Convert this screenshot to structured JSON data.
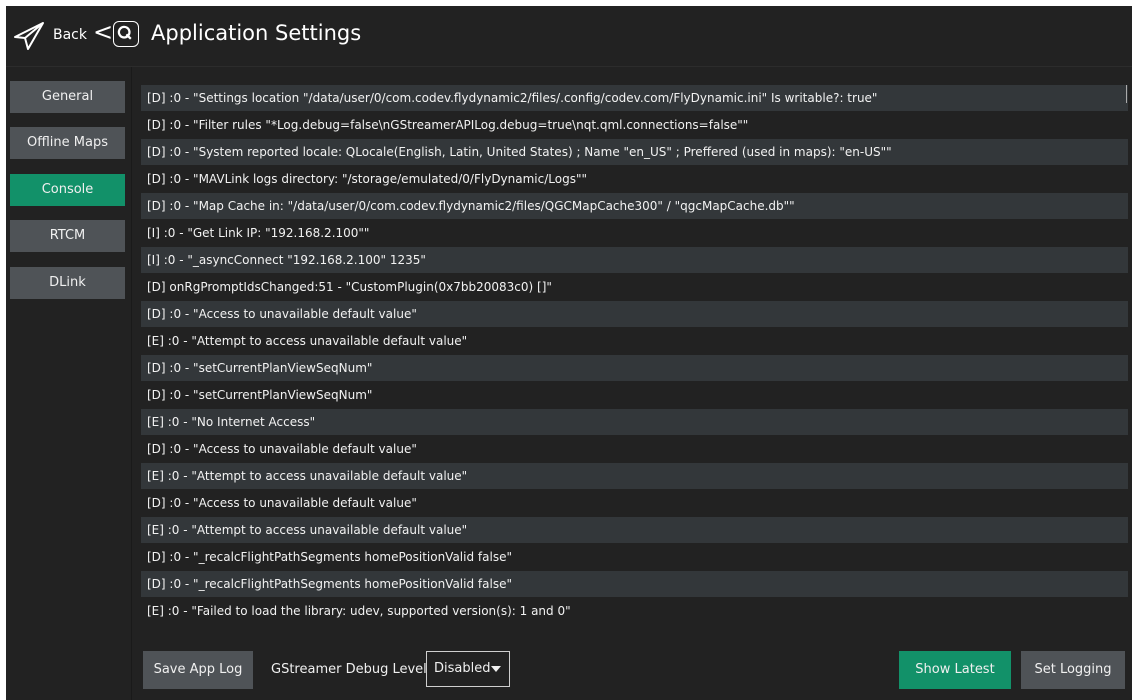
{
  "header": {
    "back_label": "Back",
    "back_chevron": "<",
    "title": "Application Settings"
  },
  "sidebar": {
    "items": [
      {
        "label": "General"
      },
      {
        "label": "Offline Maps"
      },
      {
        "label": "Console",
        "active": true
      },
      {
        "label": "RTCM"
      },
      {
        "label": "DLink"
      }
    ]
  },
  "console": {
    "lines": [
      "[D] :0 - \"Settings location \"/data/user/0/com.codev.flydynamic2/files/.config/codev.com/FlyDynamic.ini\" Is writable?: true\"",
      "[D] :0 - \"Filter rules \"*Log.debug=false\\nGStreamerAPILog.debug=true\\nqt.qml.connections=false\"\"",
      "[D] :0 - \"System reported locale: QLocale(English, Latin, United States) ; Name \"en_US\" ; Preffered (used in maps):  \"en-US\"\"",
      "[D] :0 - \"MAVLink logs directory: \"/storage/emulated/0/FlyDynamic/Logs\"\"",
      "[D] :0 - \"Map Cache in: \"/data/user/0/com.codev.flydynamic2/files/QGCMapCache300\" / \"qgcMapCache.db\"\"",
      "[I] :0 - \"Get Link IP: \"192.168.2.100\"\"",
      "[I] :0 - \"_asyncConnect \"192.168.2.100\" 1235\"",
      "[D] onRgPromptIdsChanged:51 - \"CustomPlugin(0x7bb20083c0) []\"",
      "[D] :0 - \"Access to unavailable default value\"",
      "[E] :0 - \"Attempt to access unavailable default value\"",
      "[D] :0 - \"setCurrentPlanViewSeqNum\"",
      "[D] :0 - \"setCurrentPlanViewSeqNum\"",
      "[E] :0 - \"No Internet Access\"",
      "[D] :0 - \"Access to unavailable default value\"",
      "[E] :0 - \"Attempt to access unavailable default value\"",
      "[D] :0 - \"Access to unavailable default value\"",
      "[E] :0 - \"Attempt to access unavailable default value\"",
      "[D] :0 - \"_recalcFlightPathSegments homePositionValid false\"",
      "[D] :0 - \"_recalcFlightPathSegments homePositionValid false\"",
      "[E] :0 - \"Failed to load the library: udev, supported version(s): 1 and 0\""
    ]
  },
  "footer": {
    "save_log_label": "Save App Log",
    "gstreamer_label": "GStreamer Debug Level",
    "gstreamer_value": "Disabled",
    "show_latest_label": "Show Latest",
    "set_logging_label": "Set Logging"
  },
  "colors": {
    "accent": "#129169",
    "button": "#4f5357",
    "background": "#222222",
    "row_alt": "#33373a"
  },
  "icons": {
    "brand": "paper-plane-icon",
    "app": "app-logo-icon",
    "select_caret": "caret-down-icon"
  }
}
